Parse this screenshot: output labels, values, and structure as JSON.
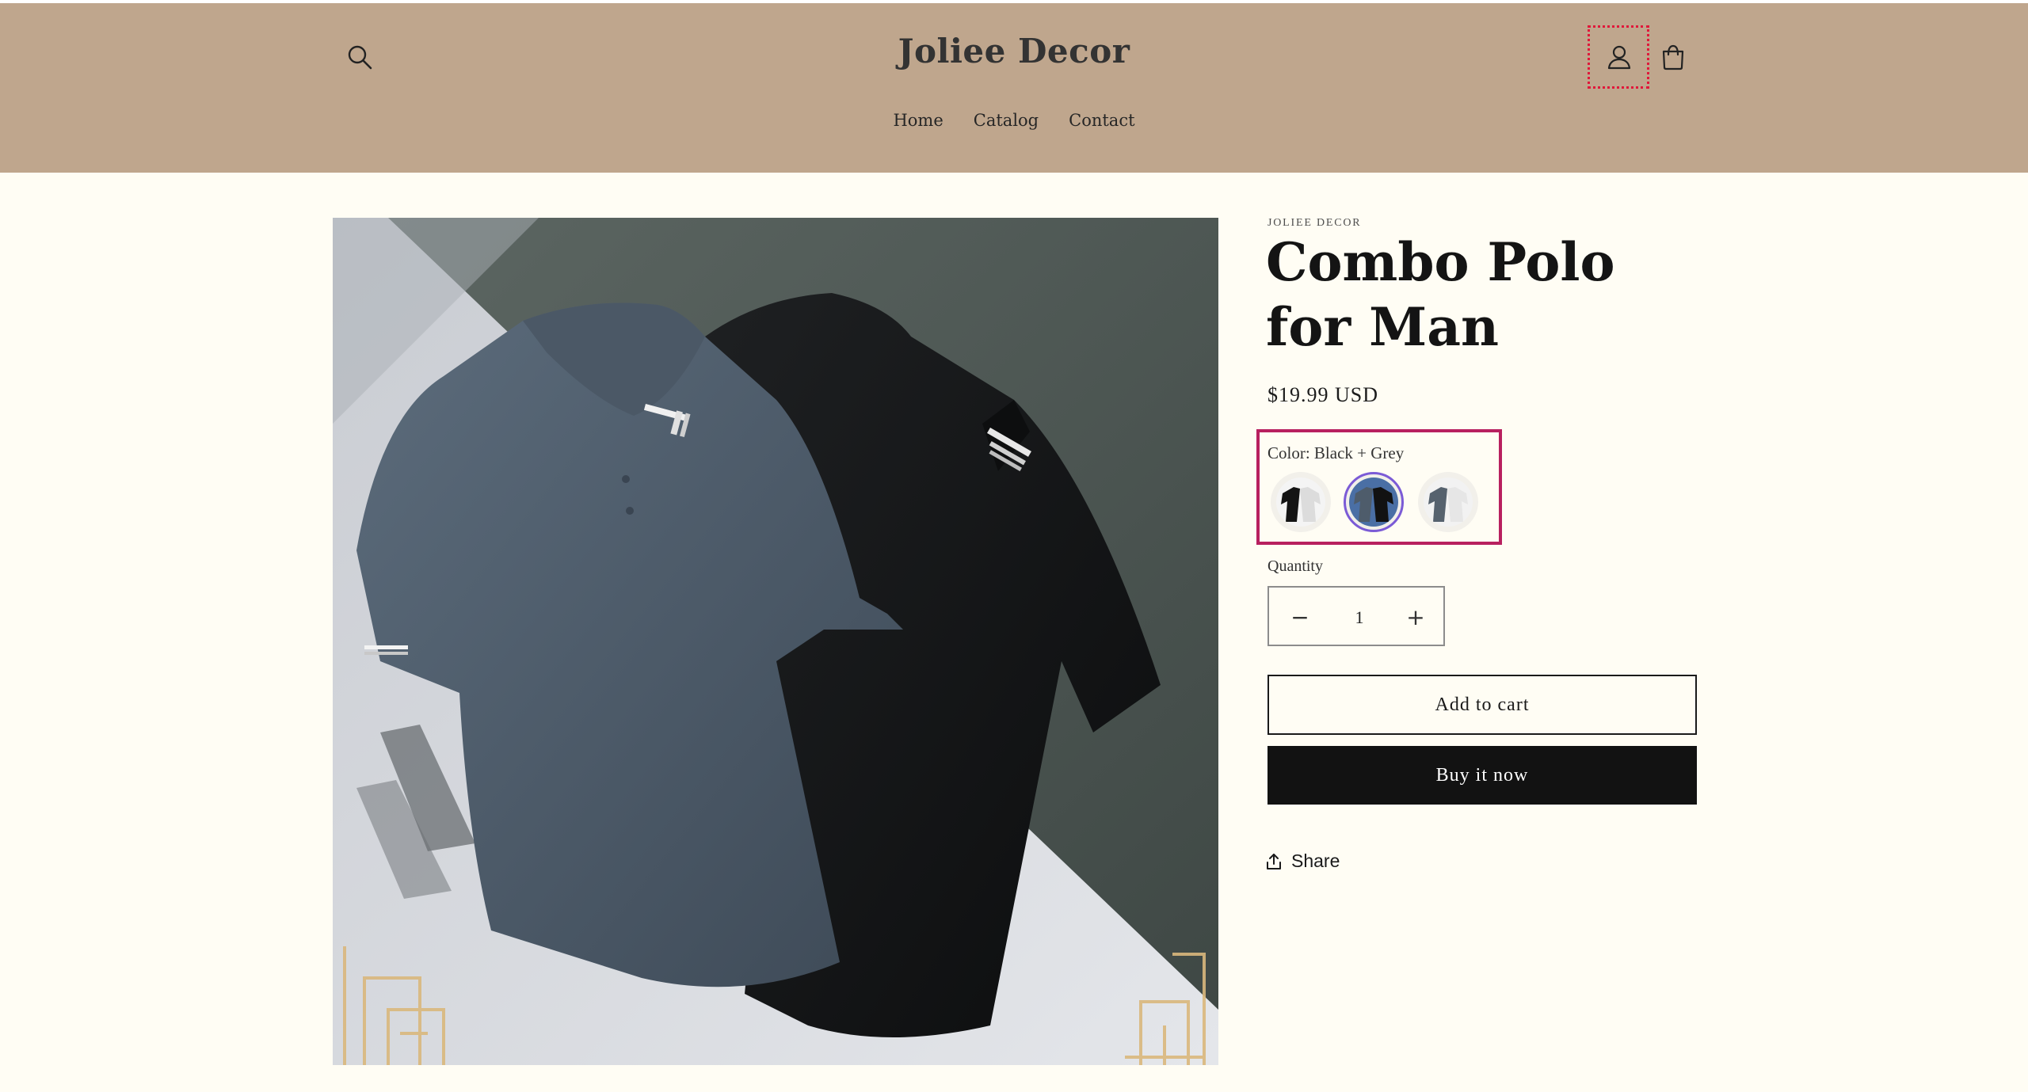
{
  "store": {
    "name": "Joliee Decor"
  },
  "nav": {
    "items": [
      {
        "label": "Home"
      },
      {
        "label": "Catalog"
      },
      {
        "label": "Contact"
      }
    ]
  },
  "header_icons": {
    "search": "search-icon",
    "account": "account-icon",
    "cart": "cart-icon"
  },
  "product": {
    "vendor": "JOLIEE DECOR",
    "title": "Combo Polo for Man",
    "price": "$19.99 USD",
    "color_label": "Color: Black + Grey",
    "swatches": [
      {
        "name": "Black + White",
        "selected": false
      },
      {
        "name": "Black + Grey",
        "selected": true
      },
      {
        "name": "Grey + White",
        "selected": false
      }
    ],
    "quantity_label": "Quantity",
    "quantity_value": "1",
    "quantity_minus": "−",
    "quantity_plus": "+",
    "add_to_cart": "Add to cart",
    "buy_now": "Buy it now",
    "share": "Share"
  },
  "colors": {
    "header_bg": "#bfa68d",
    "page_bg": "#fffdf4",
    "primary_button": "#121212",
    "variant_highlight": "#b8205f",
    "selected_swatch": "#7b5bd6"
  }
}
